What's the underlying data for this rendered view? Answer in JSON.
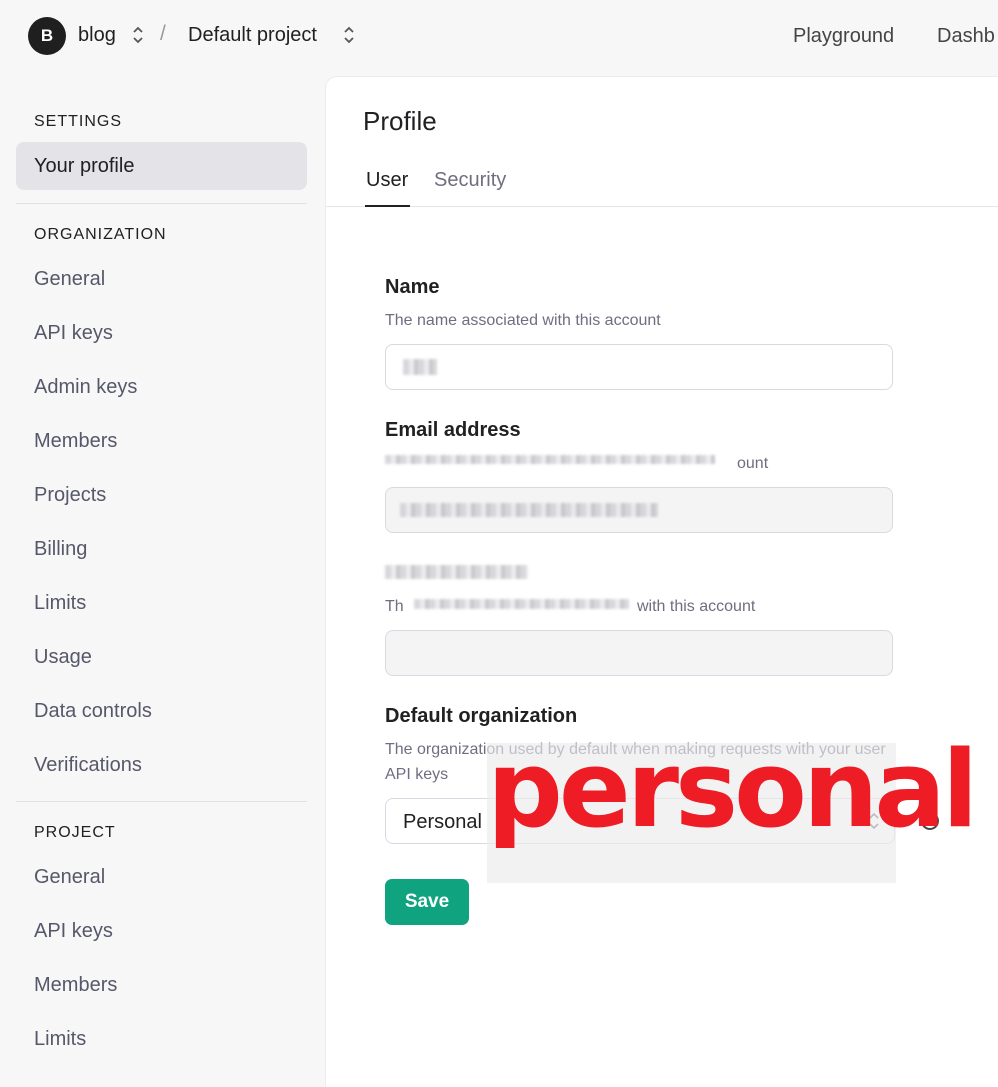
{
  "topbar": {
    "avatar_letter": "B",
    "org_name": "blog",
    "separator": "/",
    "project_name": "Default project",
    "links": [
      "Playground",
      "Dashb"
    ]
  },
  "sidebar": {
    "settings_heading": "SETTINGS",
    "settings_items": [
      "Your profile"
    ],
    "organization_heading": "ORGANIZATION",
    "organization_items": [
      "General",
      "API keys",
      "Admin keys",
      "Members",
      "Projects",
      "Billing",
      "Limits",
      "Usage",
      "Data controls",
      "Verifications"
    ],
    "project_heading": "PROJECT",
    "project_items": [
      "General",
      "API keys",
      "Members",
      "Limits"
    ]
  },
  "main": {
    "title": "Profile",
    "tabs": [
      "User",
      "Security"
    ],
    "active_tab": "User",
    "name": {
      "label": "Name",
      "description": "The name associated with this account"
    },
    "email": {
      "label": "Email address",
      "description_tail": "ount"
    },
    "phone": {
      "description_head": "Th",
      "description_tail": "with this account"
    },
    "default_org": {
      "label": "Default organization",
      "description": "The organization used by default when making requests with your user API keys",
      "selected": "Personal"
    },
    "annotation": "personal",
    "save_label": "Save"
  },
  "colors": {
    "accent": "#10a37f",
    "annotation": "#ee1c25"
  }
}
